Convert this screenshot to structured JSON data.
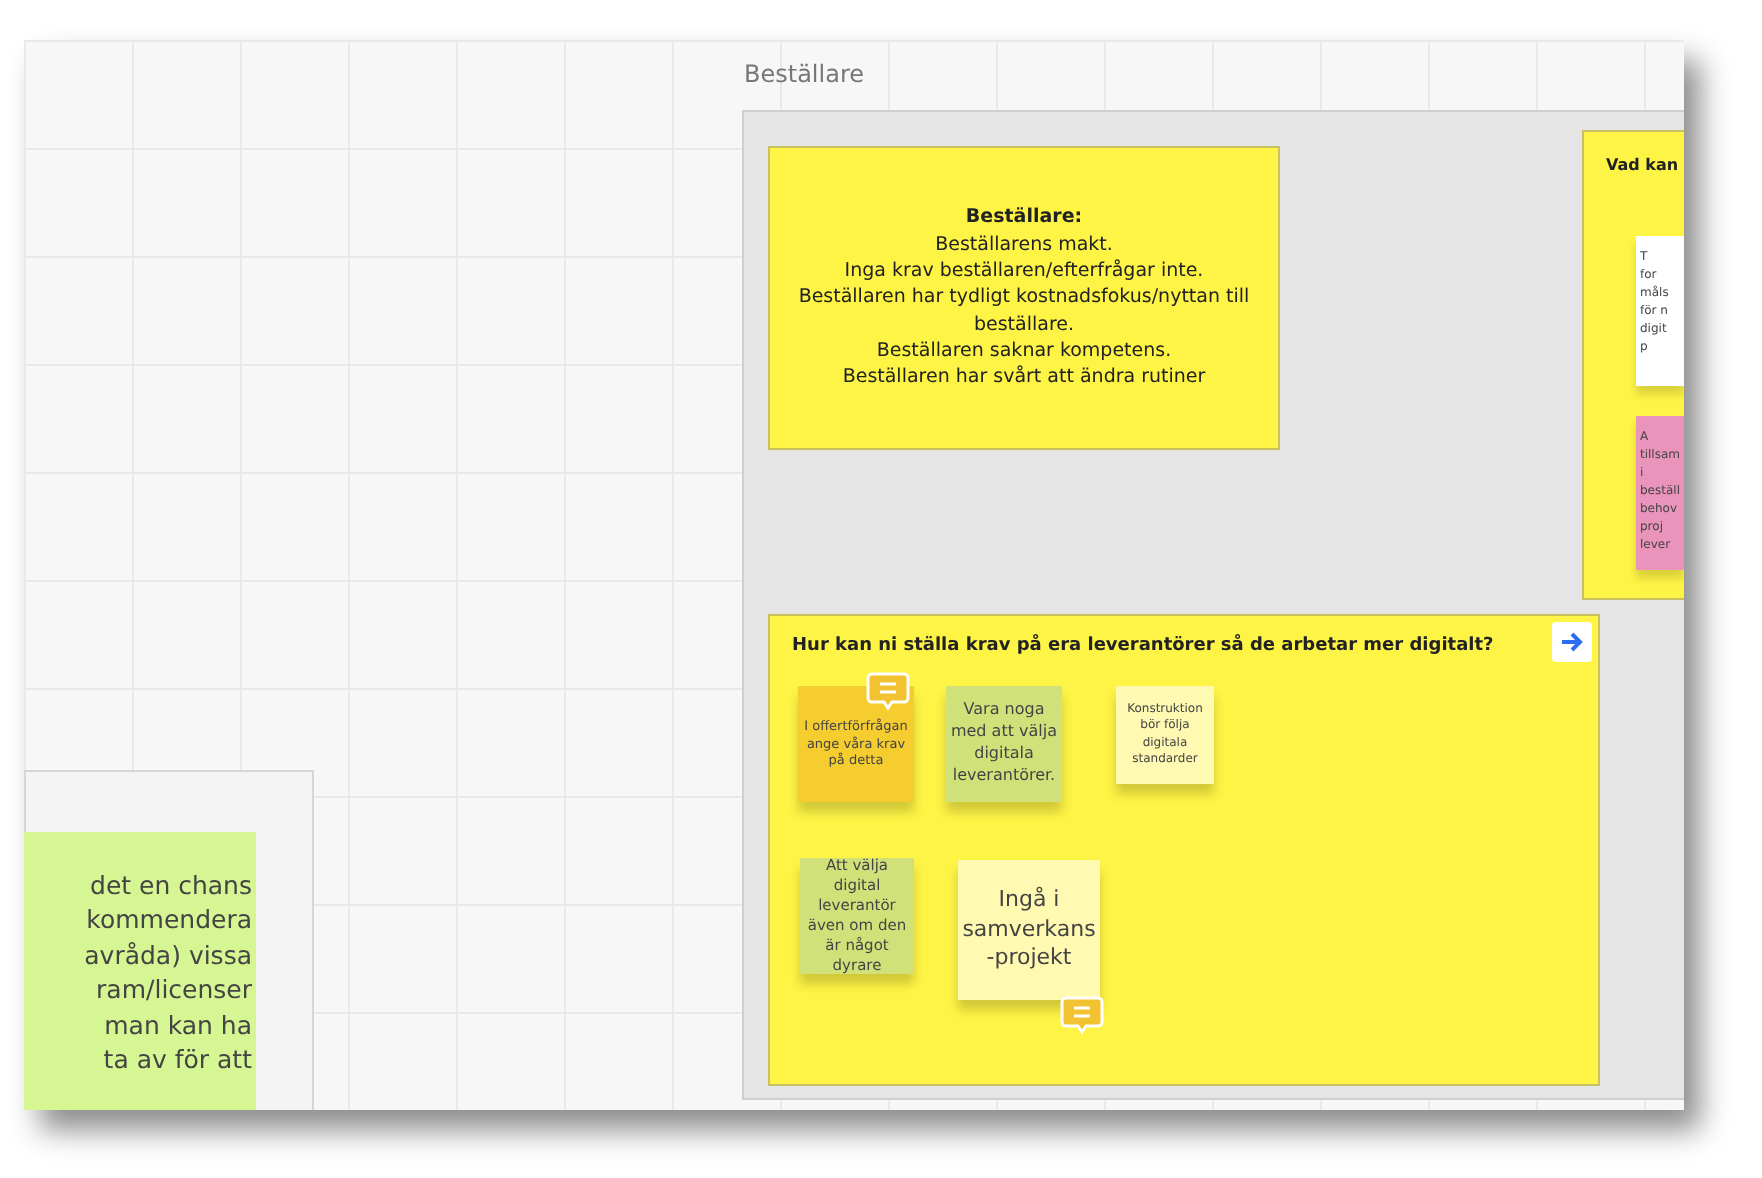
{
  "board_frames": [
    {
      "title": "Beställare",
      "kind": "gray"
    },
    {
      "title": "Vad kan",
      "kind": "yellow"
    },
    {
      "kind": "plain"
    }
  ],
  "cards": [
    {
      "heading": "Beställare:",
      "lines": [
        "Beställarens makt.",
        "Inga krav beställaren/efterfrågar inte.",
        "Beställaren har tydligt kostnadsfokus/nyttan till beställare.",
        "Beställaren saknar kompetens.",
        "Beställaren har svårt att ändra rutiner"
      ]
    }
  ],
  "question_frame": {
    "title": "Hur kan ni ställa krav på era leverantörer så de arbetar mer digitalt?",
    "notes": [
      {
        "text": "I offertförfrågan ange våra krav på detta",
        "color": "#f5cd2f",
        "has_comment": true
      },
      {
        "text": "Vara noga med att välja digitala leverantörer.",
        "color": "#d0e17a",
        "has_comment": false
      },
      {
        "text": "Konstruktion bör följa digitala standarder",
        "color": "#fff9b1",
        "has_comment": false
      },
      {
        "text": "Att välja digital leverantör även om den är något dyrare",
        "color": "#d0e17a",
        "has_comment": false
      },
      {
        "text": "Ingå i samverkans-projekt",
        "color": "#fff9b1",
        "has_comment": true
      }
    ]
  },
  "side_notes": [
    {
      "text": "T\nfor\nmåls\nför n\ndigit\np",
      "color": "#ffffff"
    },
    {
      "text": "A\ntillsam\ni\nbeställ\nbehov\nproj\nlever",
      "color": "#ea94bb"
    }
  ],
  "left_note": {
    "lines": [
      "det en chans",
      "kommendera",
      "avråda) vissa",
      "ram/licenser",
      "man kan ha",
      "ta av för att"
    ],
    "color": "#d5f692"
  }
}
